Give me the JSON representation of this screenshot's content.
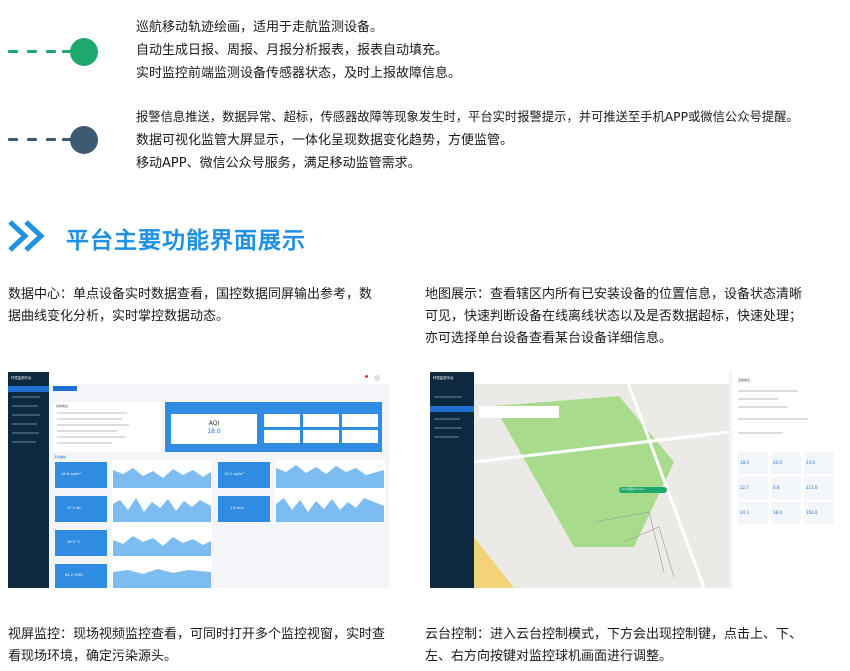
{
  "features": {
    "group1": [
      "巡航移动轨迹绘画，适用于走航监测设备。",
      "自动生成日报、周报、月报分析报表，报表自动填充。",
      "实时监控前端监测设备传感器状态，及时上报故障信息。"
    ],
    "group2": [
      "报警信息推送，数据异常、超标，传感器故障等现象发生时，平台实时报警提示，并可推送至手机APP或微信公众号提醒。",
      "数据可视化监管大屏显示，一体化呈现数据变化趋势，方便监管。",
      "移动APP、微信公众号服务，满足移动监管需求。"
    ],
    "group1_color": "#1fa86e",
    "group2_color": "#3d5a73"
  },
  "section": {
    "title": "平台主要功能界面展示",
    "accent": "#1e90e6"
  },
  "descriptions": {
    "data_center": [
      "数据中心：单点设备实时数据查看，国控数据同屏输出参考，数",
      "据曲线变化分析，实时掌控数据动态。"
    ],
    "map_view": [
      "地图展示：查看辖区内所有已安装设备的位置信息，设备状态清晰",
      "可见，快速判断设备在线离线状态以及是否数据超标，快速处理；",
      "亦可选择单台设备查看某台设备详细信息。"
    ],
    "video_monitor": [
      "视屏监控：现场视频监控查看，可同时打开多个监控视窗，实时查",
      "看现场环境，确定污染源头。"
    ],
    "ptz_control": [
      "云台控制：进入云台控制模式，下方会出现控制键，点击上、下、",
      "左、右方向按键对监控球机画面进行调整。"
    ]
  },
  "screenshot_left": {
    "app_title": "环境监测平台",
    "aqi_label": "AQI",
    "aqi_value": "18.0",
    "cards": [
      "16.8 ug/m³",
      "37.1 db",
      "7.9 m",
      "18.0 °C",
      "64.2 %RH",
      "12.1 ug/m³",
      "1.6 m/s"
    ],
    "panel_title": "基本信息",
    "trend_title": "实时曲线"
  },
  "screenshot_right": {
    "app_title": "环境监测平台",
    "info_title": "设备信息",
    "map_tag": "xxxx监测点xxxxxx",
    "tiles": [
      "18.0",
      "20.0",
      "23.0",
      "12.7",
      "0.8",
      "111.0",
      "24.3",
      "18.0",
      "156.0"
    ]
  }
}
